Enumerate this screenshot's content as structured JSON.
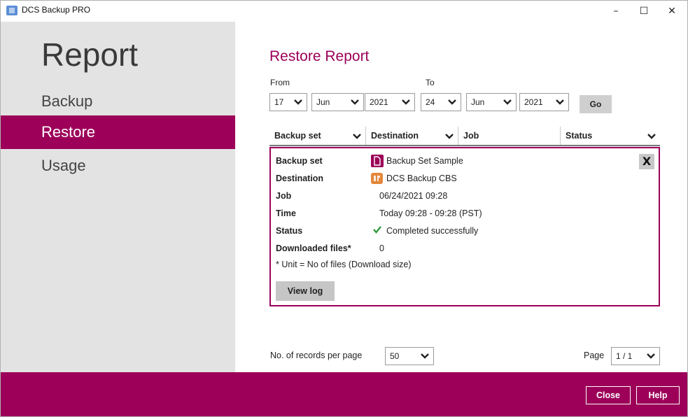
{
  "window": {
    "title": "DCS Backup PRO",
    "minimize_glyph": "–",
    "maximize_glyph": "☐",
    "close_glyph": "✕"
  },
  "sidebar": {
    "title": "Report",
    "items": [
      {
        "label": "Backup",
        "active": false
      },
      {
        "label": "Restore",
        "active": true
      },
      {
        "label": "Usage",
        "active": false
      }
    ]
  },
  "main": {
    "title": "Restore Report",
    "from_label": "From",
    "to_label": "To",
    "from": {
      "day": "17",
      "month": "Jun",
      "year": "2021"
    },
    "to": {
      "day": "24",
      "month": "Jun",
      "year": "2021"
    },
    "go_label": "Go",
    "columns": [
      "Backup set",
      "Destination",
      "Job",
      "Status"
    ]
  },
  "detail": {
    "close_label": "X",
    "rows": [
      {
        "label": "Backup set",
        "value": "Backup Set Sample",
        "icon": "file-icon"
      },
      {
        "label": "Destination",
        "value": "DCS Backup CBS",
        "icon": "dcs-logo-icon"
      },
      {
        "label": "Job",
        "value": "06/24/2021 09:28"
      },
      {
        "label": "Time",
        "value": "Today 09:28 - 09:28 (PST)"
      },
      {
        "label": "Status",
        "value": "Completed successfully",
        "icon": "check-icon"
      },
      {
        "label": "Downloaded files*",
        "value": "0"
      }
    ],
    "note": "* Unit = No of files (Download size)",
    "view_log_label": "View log"
  },
  "pagination": {
    "records_label": "No. of records per page",
    "records_value": "50",
    "page_label": "Page",
    "page_value": "1 / 1"
  },
  "footer": {
    "close_label": "Close",
    "help_label": "Help"
  },
  "colors": {
    "accent": "#9c0059",
    "sidebar_bg": "#e3e3e3",
    "success": "#2e9b3a"
  }
}
